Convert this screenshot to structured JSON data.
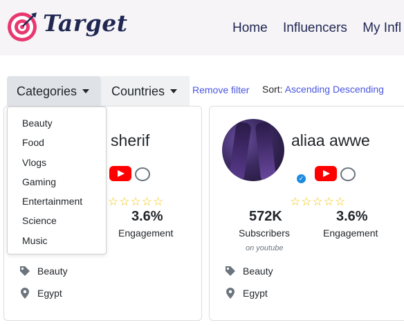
{
  "brand": {
    "name": "Target"
  },
  "nav": [
    "Home",
    "Influencers",
    "My Infl"
  ],
  "filters": {
    "categories_label": "Categories",
    "countries_label": "Countries",
    "remove_filter": "Remove filter",
    "sort_label": "Sort:",
    "sort_asc": "Ascending",
    "sort_desc": "Descending",
    "category_options": [
      "Beauty",
      "Food",
      "Vlogs",
      "Gaming",
      "Entertainment",
      "Science",
      "Music"
    ]
  },
  "cards": [
    {
      "name": "r sherif",
      "platform_icon": "youtube-icon",
      "rating_stars": 5,
      "engagement_value": "3.6%",
      "engagement_label": "Engagement",
      "category": "Beauty",
      "country": "Egypt"
    },
    {
      "name": "aliaa awwe",
      "verified": true,
      "platform_icon": "youtube-icon",
      "rating_stars": 5,
      "subscribers_value": "572K",
      "subscribers_label": "Subscribers",
      "subscribers_platform": "on youtube",
      "engagement_value": "3.6%",
      "engagement_label": "Engagement",
      "category": "Beauty",
      "country": "Egypt"
    }
  ],
  "colors": {
    "brand_navy": "#1f2752",
    "link_blue": "#4a55e0",
    "youtube_red": "#ff0000",
    "star_yellow": "#f2c400",
    "logo_pink": "#e8386f"
  }
}
